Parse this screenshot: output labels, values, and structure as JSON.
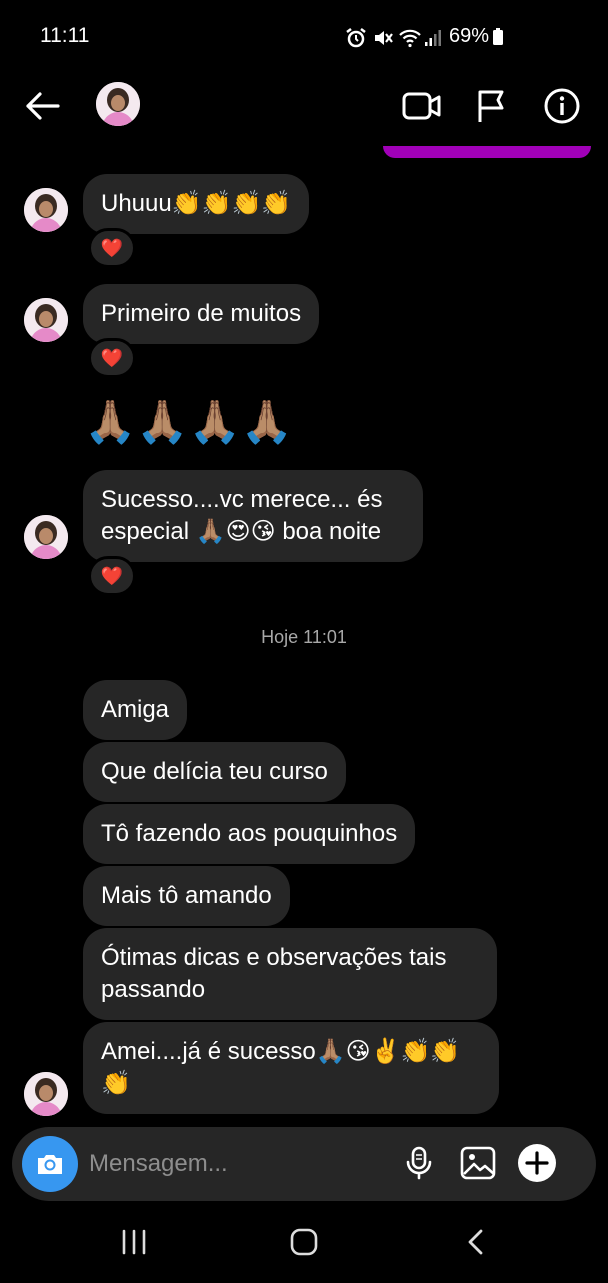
{
  "status_bar": {
    "time": "11:11",
    "battery": "69%"
  },
  "header": {
    "back_icon": "arrow-left-icon",
    "video_icon": "video-camera-icon",
    "flag_icon": "flag-icon",
    "info_icon": "info-icon"
  },
  "messages_top": [
    {
      "text": "Uhuuu👏👏👏👏",
      "reaction": "❤️"
    },
    {
      "text": "Primeiro de muitos",
      "reaction": "❤️"
    },
    {
      "text": "🙏🏽🙏🏽🙏🏽🙏🏽",
      "reaction": ""
    },
    {
      "text": "Sucesso....vc merece... és\nespecial 🙏🏽😍😘 boa noite",
      "reaction": "❤️"
    }
  ],
  "timestamp": "Hoje 11:01",
  "messages_bottom": [
    {
      "text": "Amiga"
    },
    {
      "text": "Que delícia teu curso"
    },
    {
      "text": "Tô fazendo aos pouquinhos"
    },
    {
      "text": "Mais tô amando"
    },
    {
      "text": "Ótimas dicas e observações tais\npassando"
    },
    {
      "text": "Amei....já é sucesso🙏🏽😘✌️👏👏\n👏"
    }
  ],
  "composer": {
    "placeholder": "Mensagem...",
    "camera_icon": "camera-icon",
    "mic_icon": "microphone-icon",
    "gallery_icon": "image-icon",
    "plus_icon": "plus-icon"
  },
  "nav_bar": {
    "recents_icon": "recents-icon",
    "home_icon": "home-icon",
    "back_icon": "back-icon"
  },
  "colors": {
    "accent": "#3797f0",
    "bubble": "#262626",
    "strip": "#a100b8"
  }
}
